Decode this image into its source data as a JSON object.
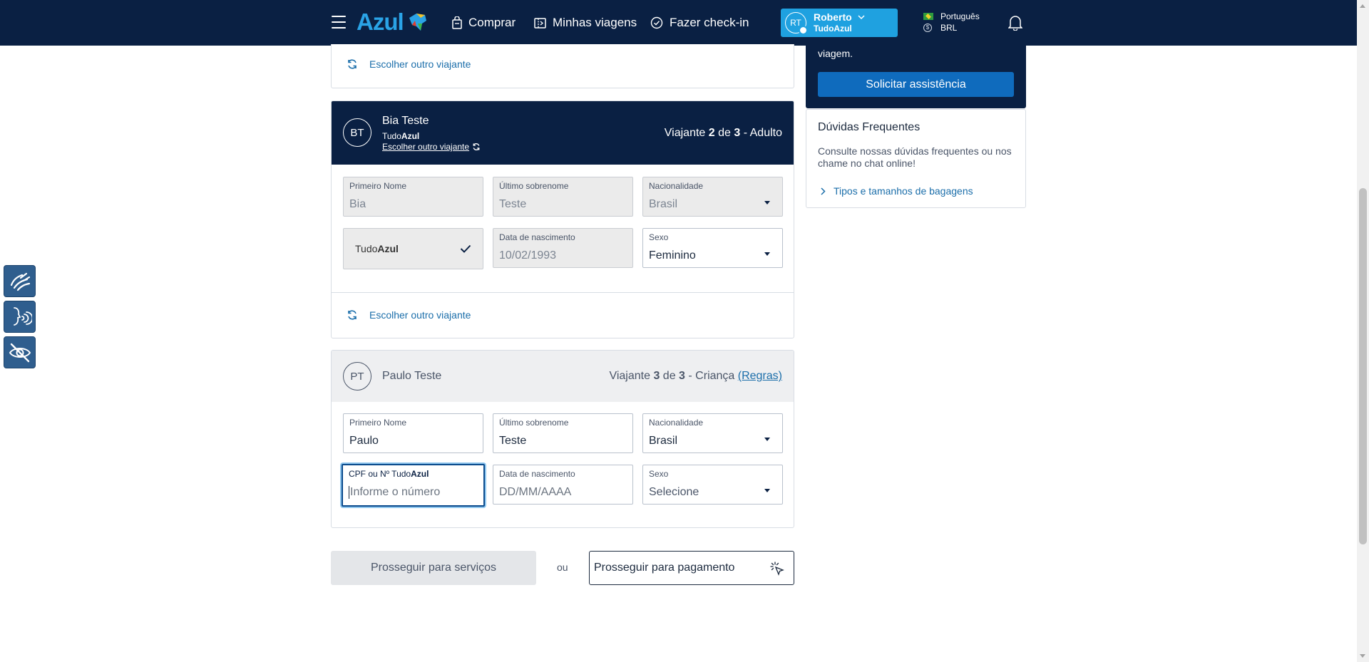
{
  "header": {
    "logo_text": "Azul",
    "nav": [
      {
        "label": "Comprar",
        "icon": "shopping-bag-icon"
      },
      {
        "label": "Minhas viagens",
        "icon": "ticket-icon"
      },
      {
        "label": "Fazer check-in",
        "icon": "check-circle-icon"
      }
    ],
    "user": {
      "initials": "RT",
      "name": "Roberto",
      "program": "TudoAzul"
    },
    "language": "Português",
    "currency": "BRL"
  },
  "colors": {
    "navy": "#0a2043",
    "accent": "#1fa1e0",
    "link": "#1b6eaa",
    "button": "#0f6bbd"
  },
  "a11y_buttons": [
    "sign-language-icon",
    "voice-reader-icon",
    "hide-visual-icon"
  ],
  "traveler1": {
    "change_label": "Escolher outro viajante"
  },
  "traveler2": {
    "initials": "BT",
    "name": "Bia Teste",
    "program_prefix": "Tudo",
    "program_bold": "Azul",
    "change_label": "Escolher outro viajante",
    "counter": {
      "prefix": "Viajante",
      "current": "2",
      "of": "de",
      "total": "3",
      "type": "- Adulto"
    },
    "fields": {
      "first_name": {
        "label": "Primeiro Nome",
        "value": "Bia"
      },
      "last_name": {
        "label": "Último sobrenome",
        "value": "Teste"
      },
      "nationality": {
        "label": "Nacionalidade",
        "value": "Brasil"
      },
      "tudoazul_prefix": "Tudo",
      "tudoazul_bold": "Azul",
      "birth_date": {
        "label": "Data de nascimento",
        "value": "10/02/1993"
      },
      "sex": {
        "label": "Sexo",
        "value": "Feminino"
      }
    },
    "change_footer_label": "Escolher outro viajante"
  },
  "traveler3": {
    "initials": "PT",
    "name": "Paulo Teste",
    "counter": {
      "prefix": "Viajante",
      "current": "3",
      "of": "de",
      "total": "3",
      "type": "- Criança",
      "rules": "(Regras)"
    },
    "fields": {
      "first_name": {
        "label": "Primeiro Nome",
        "value": "Paulo"
      },
      "last_name": {
        "label": "Último sobrenome",
        "value": "Teste"
      },
      "nationality": {
        "label": "Nacionalidade",
        "value": "Brasil"
      },
      "cpf": {
        "label_prefix": "CPF ou Nº Tudo",
        "label_bold": "Azul",
        "placeholder": "Informe o número"
      },
      "birth_date": {
        "label": "Data de nascimento",
        "placeholder": "DD/MM/AAAA"
      },
      "sex": {
        "label": "Sexo",
        "value": "Selecione"
      }
    }
  },
  "actions": {
    "services": "Prosseguir para serviços",
    "or": "ou",
    "payment": "Prosseguir para pagamento"
  },
  "sidebar": {
    "assist_text": "viagem.",
    "assist_button": "Solicitar assistência",
    "faq_title": "Dúvidas Frequentes",
    "faq_desc": "Consulte nossas dúvidas frequentes ou nos chame no chat online!",
    "faq_link": "Tipos e tamanhos de bagagens"
  }
}
